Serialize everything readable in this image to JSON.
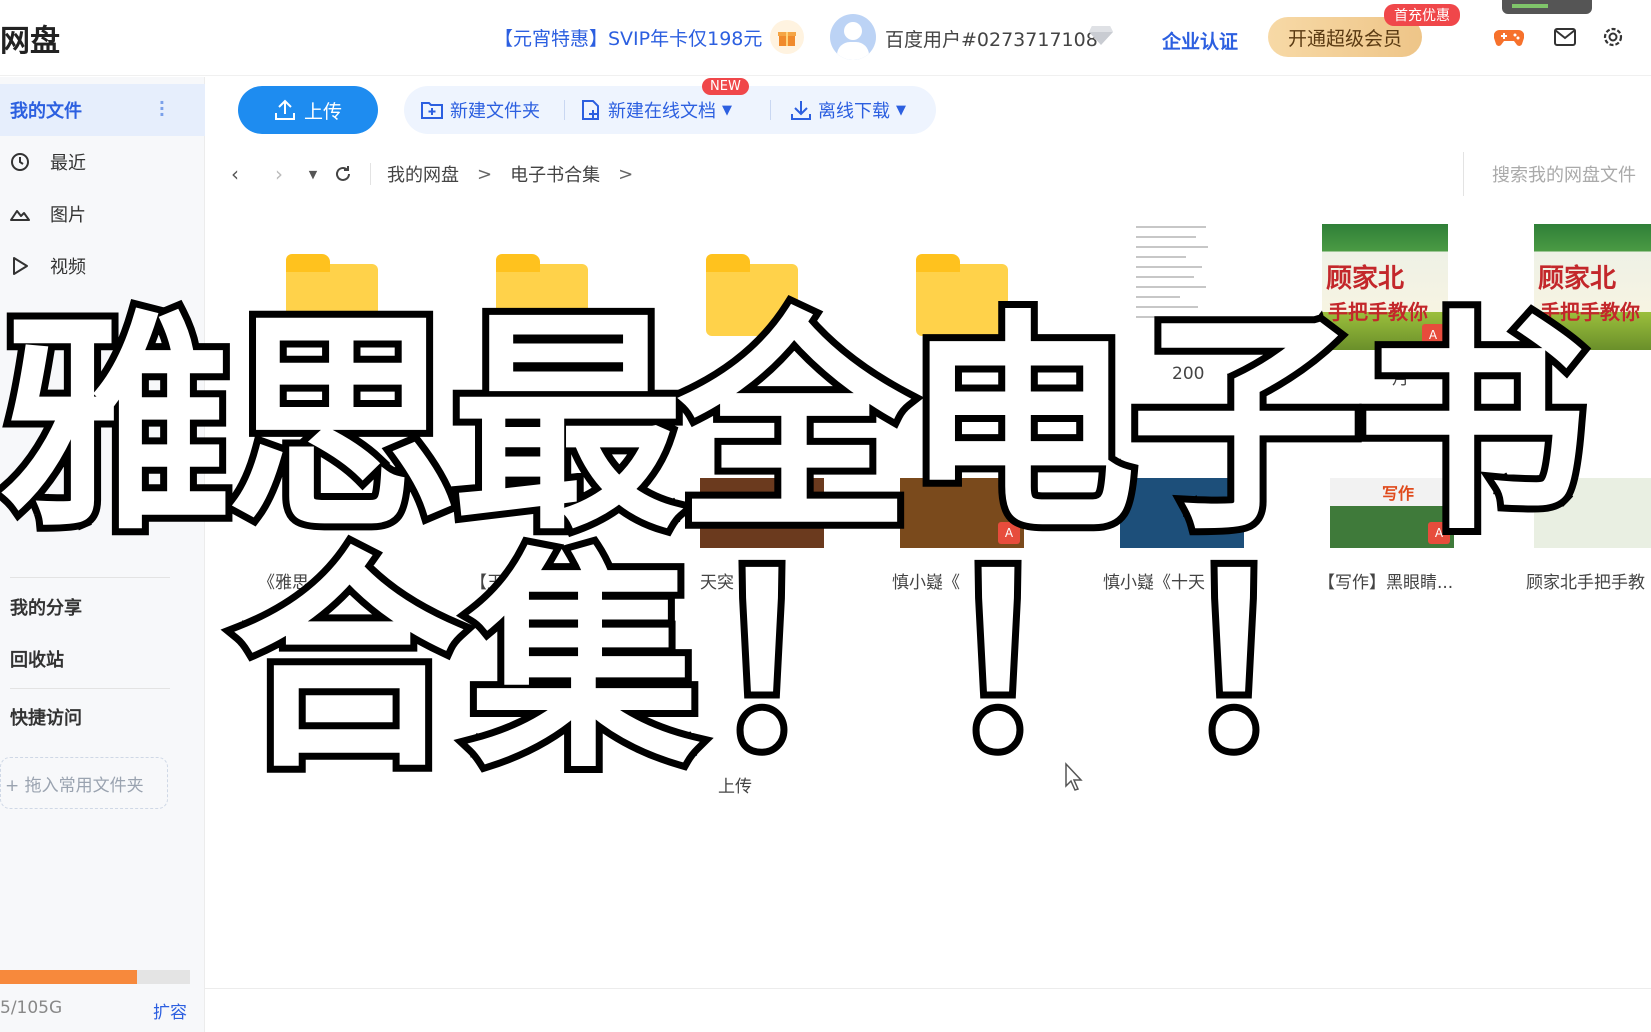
{
  "app": {
    "brand": "网盘"
  },
  "header": {
    "promo": "【元宵特惠】SVIP年卡仅198元",
    "username": "百度用户#0273717108",
    "enterprise": "企业认证",
    "vip_button": "开通超级会员",
    "vip_badge": "首充优惠"
  },
  "sidebar": {
    "items": [
      {
        "label": "我的文件",
        "icon": "folder-icon"
      },
      {
        "label": "最近",
        "icon": "clock-icon"
      },
      {
        "label": "图片",
        "icon": "cloud-image-icon"
      },
      {
        "label": "视频",
        "icon": "play-icon"
      }
    ],
    "share": "我的分享",
    "trash": "回收站",
    "quick_access": "快捷访问",
    "drop_hint": "+ 拖入常用文件夹",
    "quota_text": "5/105G",
    "quota_fraction": 0.72,
    "expand": "扩容"
  },
  "toolbar": {
    "upload": "上传",
    "new_folder": "新建文件夹",
    "new_online_doc": "新建在线文档",
    "new_badge": "NEW",
    "offline_download": "离线下载"
  },
  "breadcrumb": {
    "root": "我的网盘",
    "current": "电子书合集",
    "search_placeholder": "搜索我的网盘文件"
  },
  "files": {
    "row1_visible_labels": [
      "200",
      "月"
    ],
    "book_title": "顾家北",
    "book_subtitle": "手把手教你",
    "row2_names": [
      "《雅思",
      "【王",
      "天突",
      "慎小嶷《",
      "慎小嶷《十天",
      "【写作】黑眼睛...",
      "顾家北手把手教"
    ],
    "row3_partial": "上传",
    "writing_cover": "写作"
  },
  "overlay": {
    "line1": "雅思最全电子书",
    "line2": "合集！！！"
  },
  "colors": {
    "accent": "#2c5fe0",
    "upload_button": "#1e8cf0",
    "folder": "#ffd24a",
    "badge_red": "#f0474a",
    "quota_fill": "#f7893c"
  }
}
